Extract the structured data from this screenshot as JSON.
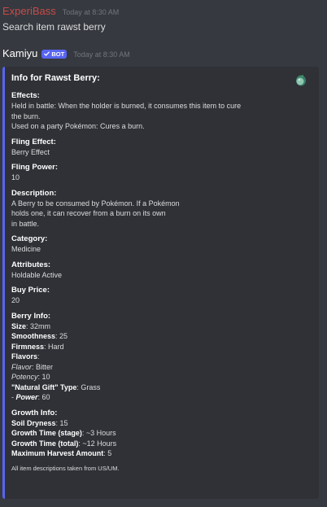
{
  "message1": {
    "username": "ExperiBass",
    "timestamp": "Today at 8:30 AM",
    "content": "Search item rawst berry"
  },
  "message2": {
    "username": "Kamiyu",
    "badge": "BOT",
    "timestamp": "Today at 8:30 AM"
  },
  "embed": {
    "accent_color": "#5865f2",
    "title": "Info for Rawst Berry:",
    "thumbnail_icon": "pokemon-item-sprite-icon",
    "effects_label": "Effects:",
    "effects_line1": "Held in battle: When the holder is burned, it consumes this item to cure",
    "effects_line2": "the burn.",
    "effects_line3": "Used on a party Pokémon: Cures a burn.",
    "fling_effect_label": "Fling Effect:",
    "fling_effect": "Berry Effect",
    "fling_power_label": "Fling Power:",
    "fling_power": "10",
    "description_label": "Description:",
    "description_line1": "A Berry to be consumed by Pokémon. If a Pokémon",
    "description_line2": "holds one, it can recover from a burn on its own",
    "description_line3": "in battle.",
    "category_label": "Category:",
    "category": "Medicine",
    "attributes_label": "Attributes:",
    "attributes": "Holdable Active",
    "buy_price_label": "Buy Price:",
    "buy_price": "20",
    "berry_info_label": "Berry Info:",
    "size_label": "Size",
    "size": ": 32mm",
    "smoothness_label": "Smoothness",
    "smoothness": ": 25",
    "firmness_label": "Firmness",
    "firmness": ": Hard",
    "flavors_label": "Flavors",
    "flavors_colon": ":",
    "flavor_label": "Flavor",
    "flavor": ": Bitter",
    "potency_label": "Potency",
    "potency": ": 10",
    "natural_gift_type_label": "\"Natural Gift\" Type",
    "natural_gift_type": ": Grass",
    "power_prefix": "- ",
    "power_label": "Power",
    "power": ": 60",
    "growth_info_label": "Growth Info:",
    "soil_dryness_label": "Soil Dryness",
    "soil_dryness": ": 15",
    "growth_stage_label": "Growth Time (stage)",
    "growth_stage": ": ~3 Hours",
    "growth_total_label": "Growth Time (total)",
    "growth_total": ": ~12 Hours",
    "max_harvest_label": "Maximum Harvest Amount",
    "max_harvest": ": 5",
    "footer": "All item descriptions taken from US/UM."
  }
}
